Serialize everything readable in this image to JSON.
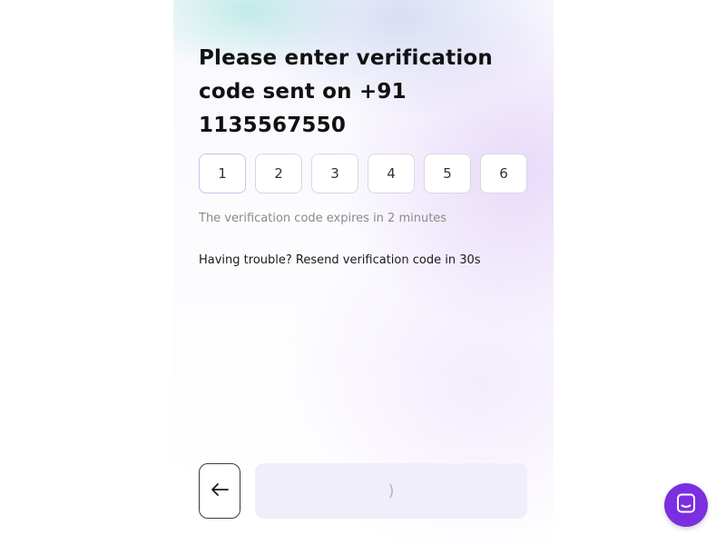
{
  "verification": {
    "title_line1": "Please enter verification",
    "title_line2": "code sent on +91 1135567550",
    "code_digits": [
      "1",
      "2",
      "3",
      "4",
      "5",
      "6"
    ],
    "expiry_text": "The verification code expires in 2 minutes",
    "resend_text": "Having trouble? Resend verification code in 30s"
  },
  "actions": {
    "back_icon": "arrow-left-icon",
    "submit_state": "loading",
    "spinner_glyph": ")"
  },
  "chat": {
    "icon": "chat-bubble-icon",
    "color": "#7b2fe0"
  }
}
